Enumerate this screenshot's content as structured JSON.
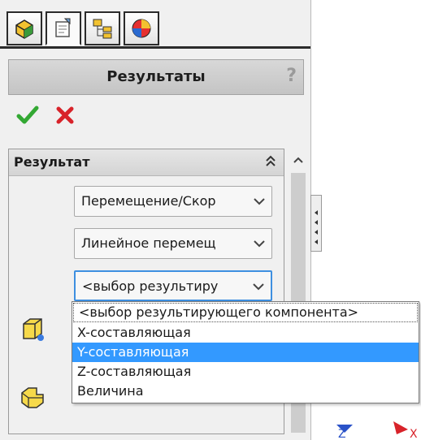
{
  "header": {
    "title": "Результаты",
    "help": "?"
  },
  "tabs": [
    {
      "name": "feature-manager"
    },
    {
      "name": "property-manager"
    },
    {
      "name": "configuration-manager"
    },
    {
      "name": "display-manager"
    }
  ],
  "group": {
    "title": "Результат",
    "combo_1": "Перемещение/Скор",
    "combo_2": "Линейное перемещ",
    "combo_3": "<выбор результиру"
  },
  "dropdown": {
    "options": [
      "<выбор результирующего компонента>",
      "X-составляющая",
      "Y-составляющая",
      "Z-составляющая",
      "Величина"
    ],
    "selected_index": 2
  },
  "triad": {
    "z_label": "Z",
    "x_label": "X"
  },
  "colors": {
    "accent": "#3399ff",
    "ok": "#33a833",
    "cancel": "#d8232a"
  }
}
